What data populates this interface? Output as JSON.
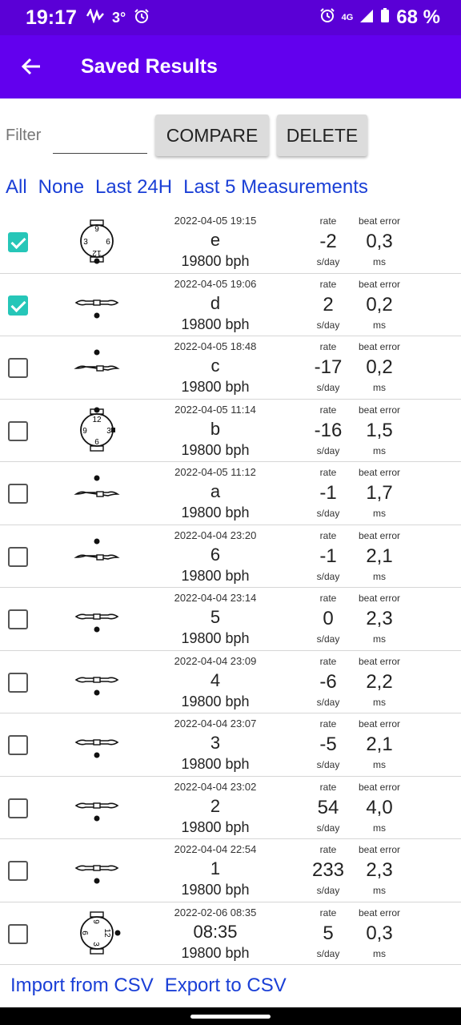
{
  "status": {
    "time": "19:17",
    "temp": "3°",
    "network": "4G",
    "battery": "68 %"
  },
  "appbar": {
    "title": "Saved Results"
  },
  "filter": {
    "label": "Filter",
    "value": ""
  },
  "buttons": {
    "compare": "COMPARE",
    "delete": "DELETE"
  },
  "quick": [
    "All",
    "None",
    "Last 24H",
    "Last 5 Measurements"
  ],
  "labels": {
    "rate": "rate",
    "rate_unit": "s/day",
    "beat_error": "beat error",
    "beat_error_unit": "ms"
  },
  "rows": [
    {
      "checked": true,
      "icon": "watch-crown-left",
      "date": "2022-04-05 19:15",
      "name": "e",
      "bph": "19800 bph",
      "rate": "-2",
      "beat_error": "0,3"
    },
    {
      "checked": true,
      "icon": "dial-up",
      "date": "2022-04-05 19:06",
      "name": "d",
      "bph": "19800 bph",
      "rate": "2",
      "beat_error": "0,2"
    },
    {
      "checked": false,
      "icon": "dial-down",
      "date": "2022-04-05 18:48",
      "name": "c",
      "bph": "19800 bph",
      "rate": "-17",
      "beat_error": "0,2"
    },
    {
      "checked": false,
      "icon": "watch-crown-up",
      "date": "2022-04-05 11:14",
      "name": "b",
      "bph": "19800 bph",
      "rate": "-16",
      "beat_error": "1,5"
    },
    {
      "checked": false,
      "icon": "dial-down",
      "date": "2022-04-05 11:12",
      "name": "a",
      "bph": "19800 bph",
      "rate": "-1",
      "beat_error": "1,7"
    },
    {
      "checked": false,
      "icon": "dial-down",
      "date": "2022-04-04 23:20",
      "name": "6",
      "bph": "19800 bph",
      "rate": "-1",
      "beat_error": "2,1"
    },
    {
      "checked": false,
      "icon": "dial-up",
      "date": "2022-04-04 23:14",
      "name": "5",
      "bph": "19800 bph",
      "rate": "0",
      "beat_error": "2,3"
    },
    {
      "checked": false,
      "icon": "dial-up",
      "date": "2022-04-04 23:09",
      "name": "4",
      "bph": "19800 bph",
      "rate": "-6",
      "beat_error": "2,2"
    },
    {
      "checked": false,
      "icon": "dial-up",
      "date": "2022-04-04 23:07",
      "name": "3",
      "bph": "19800 bph",
      "rate": "-5",
      "beat_error": "2,1"
    },
    {
      "checked": false,
      "icon": "dial-up",
      "date": "2022-04-04 23:02",
      "name": "2",
      "bph": "19800 bph",
      "rate": "54",
      "beat_error": "4,0"
    },
    {
      "checked": false,
      "icon": "dial-up",
      "date": "2022-04-04 22:54",
      "name": "1",
      "bph": "19800 bph",
      "rate": "233",
      "beat_error": "2,3"
    },
    {
      "checked": false,
      "icon": "watch-crown-right",
      "date": "2022-02-06 08:35",
      "name": "08:35",
      "bph": "19800 bph",
      "rate": "5",
      "beat_error": "0,3"
    }
  ],
  "footer": {
    "import": "Import from CSV",
    "export": "Export to CSV"
  },
  "colors": {
    "statusbar": "#5a00d6",
    "appbar": "#6200ee",
    "link": "#1a3fd6",
    "checkbox": "#26c6b8"
  }
}
